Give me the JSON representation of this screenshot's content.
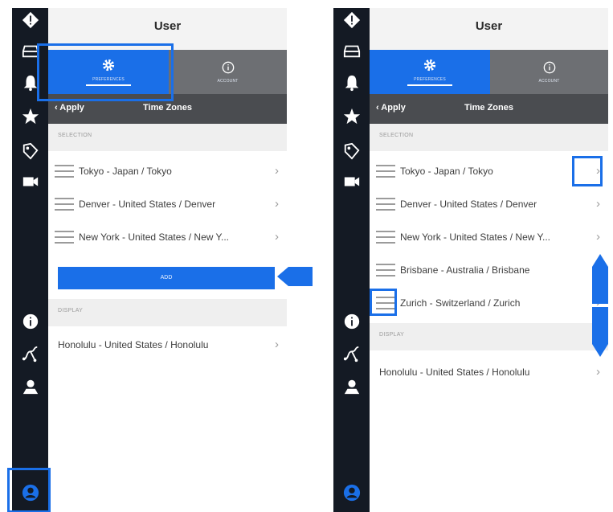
{
  "colors": {
    "accent": "#1a6fe8",
    "sidebar": "#141a24",
    "tabbar": "#6d6f73",
    "subbar": "#4a4c50"
  },
  "sidebar_icons": [
    "diamond-alert-icon",
    "inbox-icon",
    "bell-icon",
    "star-icon",
    "tag-icon",
    "video-camera-icon",
    "info-icon",
    "route-icon",
    "map-pin-icon",
    "user-icon"
  ],
  "left": {
    "title": "User",
    "tabs": {
      "preferences": "PREFERENCES",
      "account": "ACCOUNT"
    },
    "subbar": {
      "back": "‹ Apply",
      "title": "Time Zones"
    },
    "selection_header": "SELECTION",
    "selection": [
      "Tokyo - Japan / Tokyo",
      "Denver - United States / Denver",
      "New York - United States / New Y..."
    ],
    "add_label": "ADD",
    "display_header": "DISPLAY",
    "display": [
      "Honolulu - United States / Honolulu"
    ]
  },
  "right": {
    "title": "User",
    "tabs": {
      "preferences": "PREFERENCES",
      "account": "ACCOUNT"
    },
    "subbar": {
      "back": "‹ Apply",
      "title": "Time Zones"
    },
    "selection_header": "SELECTION",
    "selection": [
      "Tokyo - Japan / Tokyo",
      "Denver - United States / Denver",
      "New York - United States / New Y...",
      "Brisbane - Australia / Brisbane",
      "Zurich - Switzerland / Zurich"
    ],
    "display_header": "DISPLAY",
    "display": [
      "Honolulu - United States / Honolulu"
    ]
  },
  "chevron": "›"
}
